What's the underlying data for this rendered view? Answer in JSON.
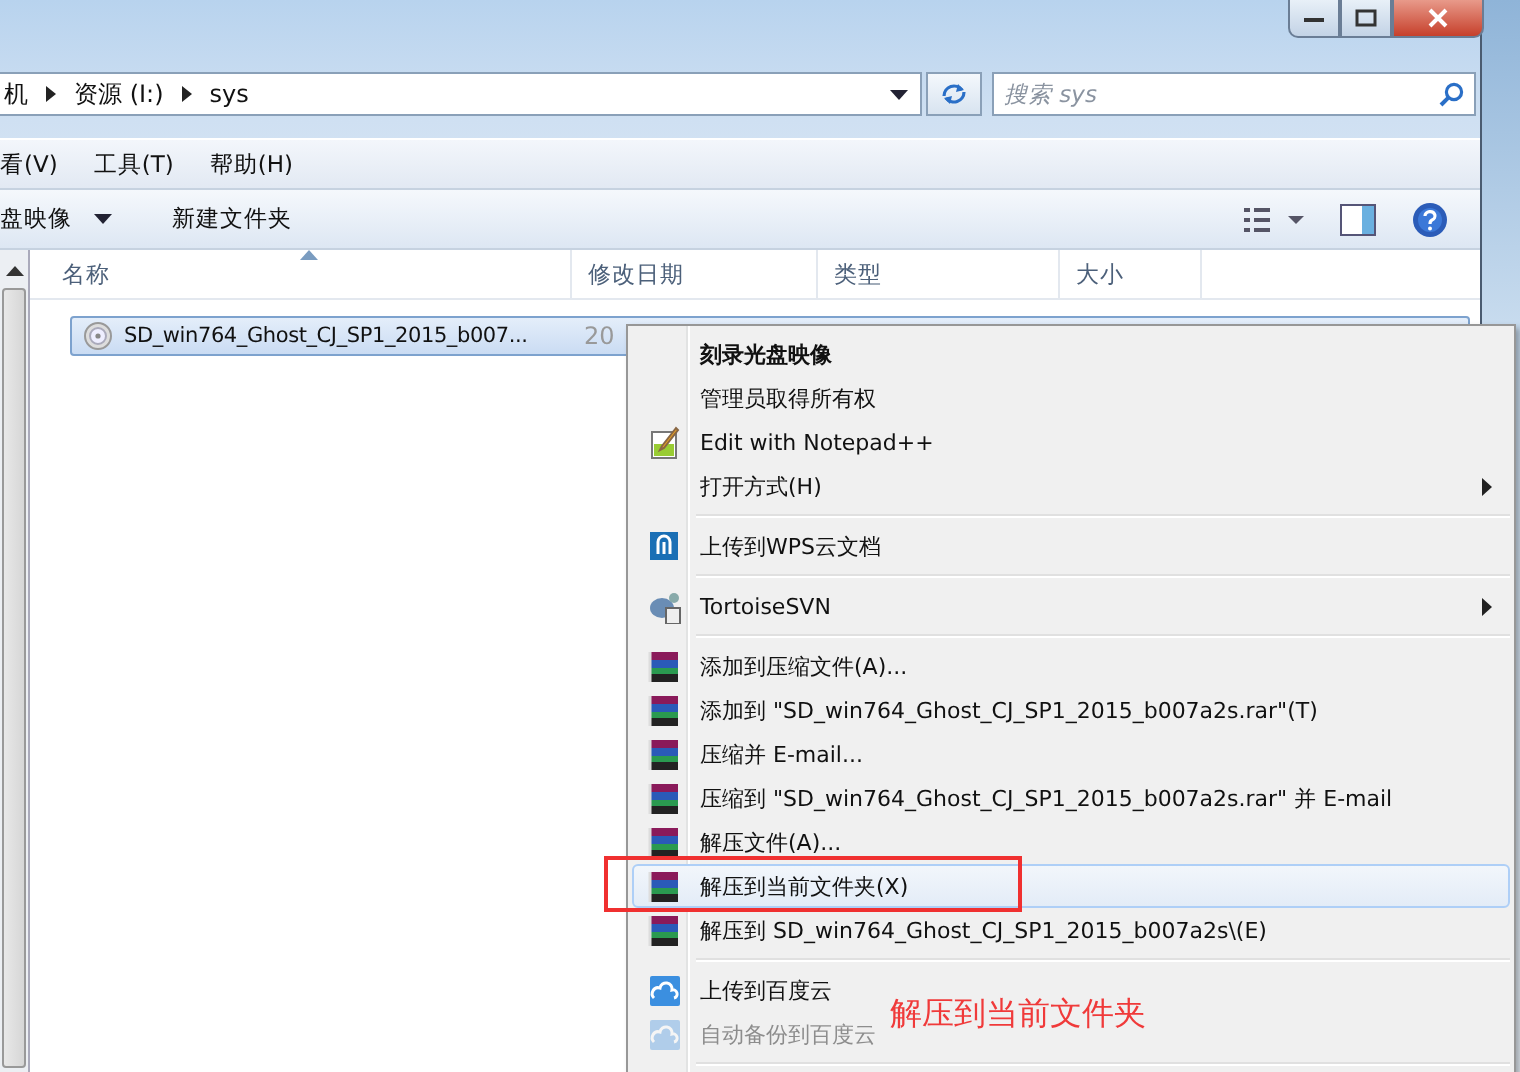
{
  "address_bar": {
    "crumbs": [
      "机",
      "资源 (I:)",
      "sys"
    ]
  },
  "search": {
    "placeholder": "搜索 sys"
  },
  "menu_bar": [
    "看(V)",
    "工具(T)",
    "帮助(H)"
  ],
  "toolbar": {
    "buttons": [
      {
        "label": "盘映像",
        "dropdown": true
      },
      {
        "label": "新建文件夹",
        "dropdown": false
      }
    ]
  },
  "columns": [
    {
      "label": "名称",
      "sorted": true
    },
    {
      "label": "修改日期",
      "sorted": false
    },
    {
      "label": "类型",
      "sorted": false
    },
    {
      "label": "大小",
      "sorted": false
    }
  ],
  "files": [
    {
      "name": "SD_win764_Ghost_CJ_SP1_2015_b007...",
      "date": "20",
      "selected": true
    }
  ],
  "context_menu": {
    "groups": [
      [
        {
          "label": "刻录光盘映像",
          "kind": "plain",
          "bold": true,
          "submenu": false,
          "selected": false,
          "disabled": false
        },
        {
          "label": "管理员取得所有权",
          "kind": "plain",
          "bold": false,
          "submenu": false,
          "selected": false,
          "disabled": false
        },
        {
          "label": "Edit with Notepad++",
          "kind": "notepad",
          "bold": false,
          "submenu": false,
          "selected": false,
          "disabled": false
        },
        {
          "label": "打开方式(H)",
          "kind": "plain",
          "bold": false,
          "submenu": true,
          "selected": false,
          "disabled": false
        }
      ],
      [
        {
          "label": "上传到WPS云文档",
          "kind": "wps",
          "bold": false,
          "submenu": false,
          "selected": false,
          "disabled": false
        }
      ],
      [
        {
          "label": "TortoiseSVN",
          "kind": "svn",
          "bold": false,
          "submenu": true,
          "selected": false,
          "disabled": false
        }
      ],
      [
        {
          "label": "添加到压缩文件(A)...",
          "kind": "archive",
          "bold": false,
          "submenu": false,
          "selected": false,
          "disabled": false
        },
        {
          "label": "添加到 \"SD_win764_Ghost_CJ_SP1_2015_b007a2s.rar\"(T)",
          "kind": "archive",
          "bold": false,
          "submenu": false,
          "selected": false,
          "disabled": false
        },
        {
          "label": "压缩并 E-mail...",
          "kind": "archive",
          "bold": false,
          "submenu": false,
          "selected": false,
          "disabled": false
        },
        {
          "label": "压缩到 \"SD_win764_Ghost_CJ_SP1_2015_b007a2s.rar\" 并 E-mail",
          "kind": "archive",
          "bold": false,
          "submenu": false,
          "selected": false,
          "disabled": false
        },
        {
          "label": "解压文件(A)...",
          "kind": "archive",
          "bold": false,
          "submenu": false,
          "selected": false,
          "disabled": false
        },
        {
          "label": "解压到当前文件夹(X)",
          "kind": "archive",
          "bold": false,
          "submenu": false,
          "selected": true,
          "disabled": false
        },
        {
          "label": "解压到 SD_win764_Ghost_CJ_SP1_2015_b007a2s\\(E)",
          "kind": "archive",
          "bold": false,
          "submenu": false,
          "selected": false,
          "disabled": false
        }
      ],
      [
        {
          "label": "上传到百度云",
          "kind": "cloud",
          "bold": false,
          "submenu": false,
          "selected": false,
          "disabled": false
        },
        {
          "label": "自动备份到百度云",
          "kind": "cloud",
          "bold": false,
          "submenu": false,
          "selected": false,
          "disabled": true
        }
      ]
    ]
  },
  "annotation": {
    "text": "解压到当前文件夹"
  }
}
